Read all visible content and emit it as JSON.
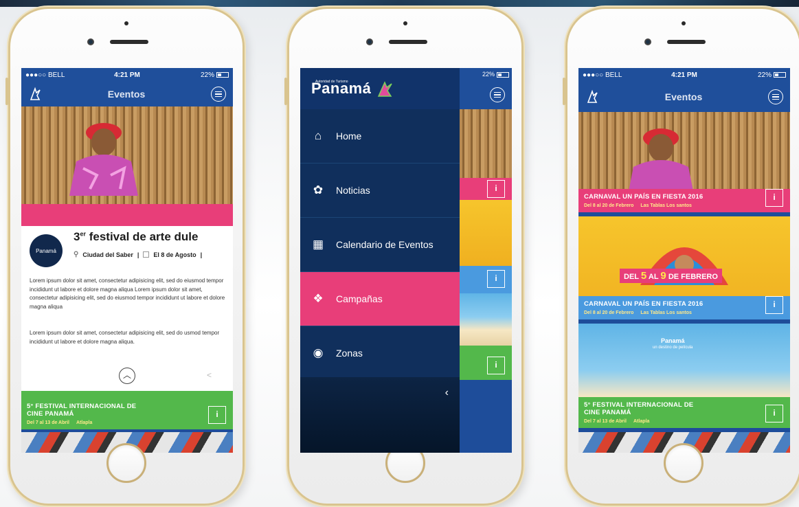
{
  "status": {
    "carrier": "●●●○○ BELL",
    "time": "4:21 PM",
    "battery": "22%"
  },
  "app": {
    "title": "Eventos",
    "brand": "Panamá",
    "brand_sub": "Autoridad de Turismo"
  },
  "detail": {
    "org_logo": "Panamá",
    "title": "festival de arte dule",
    "title_prefix": "3",
    "title_sup": "er",
    "location": "Ciudad del Saber",
    "date": "El 8 de Agosto",
    "paragraph1": "Lorem ipsum dolor sit amet, consectetur adipisicing elit, sed do eiusmod tempor incididunt ut labore et dolore magna aliqua Lorem ipsum dolor sit amet, consectetur adipisicing elit, sed do eiusmod tempor incididunt ut labore et dolore magna aliqua",
    "paragraph2": "Lorem ipsum dolor sit amet, consectetur adipisicing elit, sed do usmod tempor incididunt ut labore et dolore magna aliqua."
  },
  "events": [
    {
      "name": "CARNAVAL UN PAÍS EN FIESTA 2016",
      "dates": "Del 8 al 20 de Febrero",
      "place": "Las Tablas Los santos",
      "color": "#e83e79"
    },
    {
      "name": "CARNAVAL UN PAÍS EN FIESTA 2016",
      "dates": "Del 8 al 20 de Febrero",
      "place": "Las Tablas Los santos",
      "color": "#4a9adf"
    },
    {
      "name": "5° FESTIVAL INTERNACIONAL DE CINE PANAMÁ",
      "dates": "Del 7 al 13 de Abril",
      "place": "Atlapla",
      "color": "#53b84b"
    }
  ],
  "carnaval_banner": {
    "del": "DEL",
    "d1": "5",
    "al": "AL",
    "d2": "9",
    "de": "DE FEBRERO"
  },
  "beach_caption": {
    "brand": "Panamá",
    "tagline": "un destino de película"
  },
  "drawer": {
    "items": [
      {
        "label": "Home",
        "icon": "home-icon"
      },
      {
        "label": "Noticias",
        "icon": "news-icon"
      },
      {
        "label": "Calendario de Eventos",
        "icon": "calendar-icon"
      },
      {
        "label": "Campañas",
        "icon": "campaign-icon"
      },
      {
        "label": "Zonas",
        "icon": "eye-icon"
      }
    ],
    "active": "Campañas"
  }
}
